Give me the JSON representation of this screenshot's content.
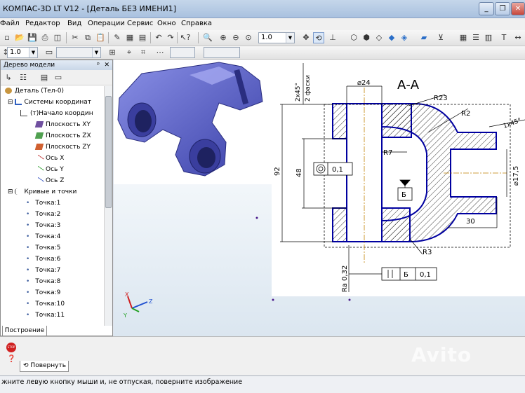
{
  "window": {
    "title": "КОМПАС-3D LT V12 - [Деталь БЕЗ ИМЕНИ1]",
    "minimize": "_",
    "restore": "❐",
    "close": "✕"
  },
  "menu": {
    "items": [
      {
        "label": "Файл"
      },
      {
        "label": "Редактор"
      },
      {
        "label": "Вид"
      },
      {
        "label": "Операции"
      },
      {
        "label": "Сервис"
      },
      {
        "label": "Окно"
      },
      {
        "label": "Справка"
      }
    ]
  },
  "toolbar": {
    "zoom_value": "1.0",
    "scale_value": "1.0"
  },
  "tree": {
    "header": "Дерево модели",
    "pin": "ф",
    "items": [
      {
        "label": "Деталь (Тел-0)",
        "icon": "part-icon"
      },
      {
        "label": "Системы координат",
        "icon": "coord-systems-icon"
      },
      {
        "label": "(т)Начало координ",
        "icon": "origin-icon"
      },
      {
        "label": "Плоскость XY",
        "icon": "plane-xy-icon"
      },
      {
        "label": "Плоскость ZX",
        "icon": "plane-zx-icon"
      },
      {
        "label": "Плоскость ZY",
        "icon": "plane-zy-icon"
      },
      {
        "label": "Ось X",
        "icon": "axis-icon"
      },
      {
        "label": "Ось Y",
        "icon": "axis-icon"
      },
      {
        "label": "Ось Z",
        "icon": "axis-icon"
      },
      {
        "label": "Кривые и точки",
        "icon": "curves-icon"
      },
      {
        "label": "Точка:1"
      },
      {
        "label": "Точка:2"
      },
      {
        "label": "Точка:3"
      },
      {
        "label": "Точка:4"
      },
      {
        "label": "Точка:5"
      },
      {
        "label": "Точка:6"
      },
      {
        "label": "Точка:7"
      },
      {
        "label": "Точка:8"
      },
      {
        "label": "Точка:9"
      },
      {
        "label": "Точка:10"
      },
      {
        "label": "Точка:11"
      }
    ],
    "tab": "Построение"
  },
  "drawing": {
    "section_label": "А-А",
    "chamfer_label": "2 фаски",
    "chamfer_value": "2x45°",
    "diam24": "⌀24",
    "r23": "R23",
    "r2": "R2",
    "r7": "R7",
    "dim92": "92",
    "dim48": "48",
    "flatness": "0,1",
    "base_b": "Б",
    "dim30": "30",
    "diam17": "⌀17,5",
    "chamfer_right": "1x45°",
    "r3": "R3",
    "roughness": "Ra 0,32",
    "parallel_base": "Б",
    "parallel_value": "0,1"
  },
  "axes": {
    "x": "X",
    "y": "Y",
    "z": "Z"
  },
  "bottom": {
    "rotate_tab": "Повернуть",
    "stop": "STOP"
  },
  "status": {
    "text": "жните левую кнопку мыши и, не отпуская, поверните изображение"
  },
  "watermark": "Avito",
  "colors": {
    "part": "#5a60c8",
    "outline": "#0000a0",
    "hatch": "#000000"
  }
}
